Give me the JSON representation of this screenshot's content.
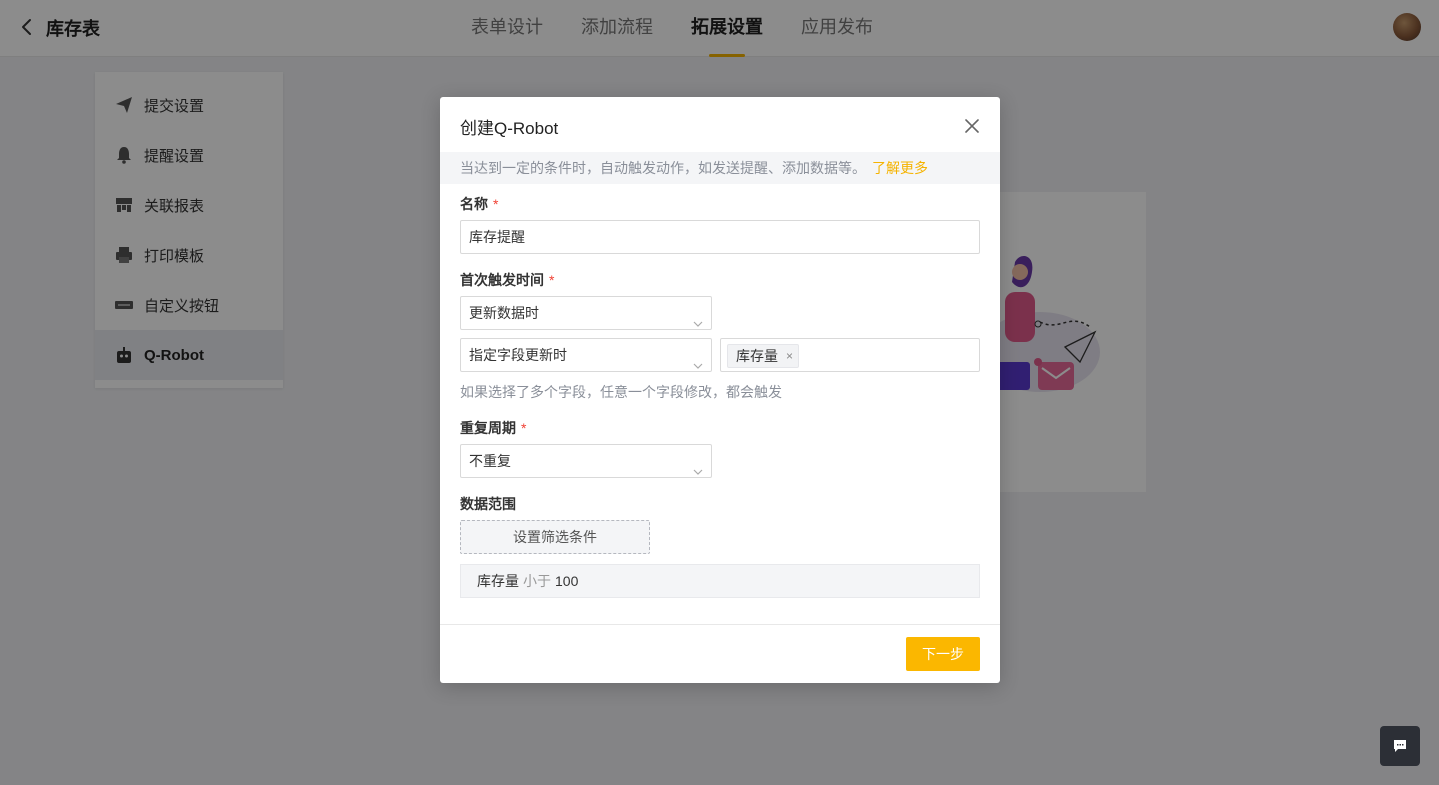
{
  "header": {
    "title": "库存表",
    "tabs": [
      {
        "label": "表单设计"
      },
      {
        "label": "添加流程"
      },
      {
        "label": "拓展设置"
      },
      {
        "label": "应用发布"
      }
    ],
    "active_tab": "拓展设置"
  },
  "sidebar": {
    "items": [
      {
        "label": "提交设置",
        "icon": "send-icon"
      },
      {
        "label": "提醒设置",
        "icon": "bell-icon"
      },
      {
        "label": "关联报表",
        "icon": "report-icon"
      },
      {
        "label": "打印模板",
        "icon": "printer-icon"
      },
      {
        "label": "自定义按钮",
        "icon": "button-icon"
      },
      {
        "label": "Q-Robot",
        "icon": "robot-icon"
      }
    ],
    "active_item": "Q-Robot"
  },
  "modal": {
    "title": "创建Q-Robot",
    "tip": "当达到一定的条件时，自动触发动作，如发送提醒、添加数据等。",
    "learn_more": "了解更多",
    "name_label": "名称",
    "name_value": "库存提醒",
    "trigger_label": "首次触发时间",
    "trigger_value": "更新数据时",
    "field_mode_value": "指定字段更新时",
    "field_tag": "库存量",
    "hint": "如果选择了多个字段，任意一个字段修改，都会触发",
    "repeat_label": "重复周期",
    "repeat_value": "不重复",
    "scope_label": "数据范围",
    "filter_button": "设置筛选条件",
    "filter": {
      "field": "库存量",
      "operator": "小于",
      "value": "100"
    },
    "next_button": "下一步",
    "required_mark": "*"
  },
  "colors": {
    "accent": "#f5b300",
    "required": "#f04134"
  }
}
